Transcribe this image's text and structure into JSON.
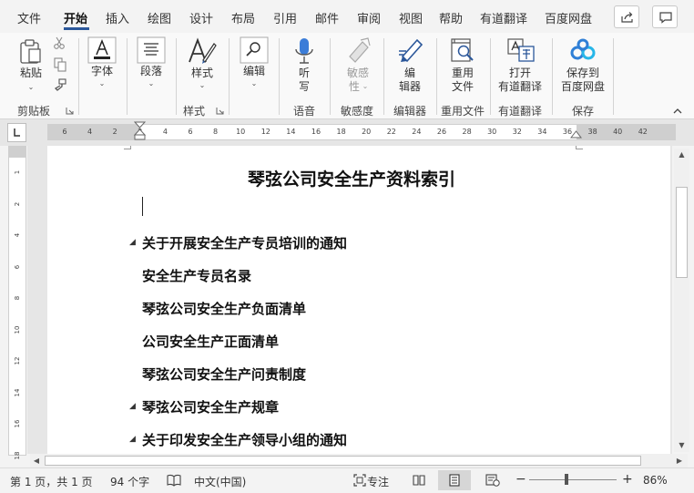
{
  "menu": {
    "items": [
      "文件",
      "开始",
      "插入",
      "绘图",
      "设计",
      "布局",
      "引用",
      "邮件",
      "审阅",
      "视图",
      "帮助",
      "有道翻译",
      "百度网盘"
    ],
    "active_index": 1
  },
  "ribbon": {
    "clipboard": {
      "paste_label": "粘贴",
      "group_label": "剪贴板"
    },
    "font": {
      "label": "字体"
    },
    "paragraph": {
      "label": "段落"
    },
    "styles": {
      "label": "样式",
      "group_label": "样式"
    },
    "editing": {
      "label": "编辑"
    },
    "voice": {
      "label1": "听",
      "label2": "写",
      "group_label": "语音"
    },
    "sensitivity": {
      "label1": "敏感",
      "label2": "性",
      "group_label": "敏感度"
    },
    "editor": {
      "label1": "编",
      "label2": "辑器",
      "group_label": "编辑器"
    },
    "reuse": {
      "label1": "重用",
      "label2": "文件",
      "group_label": "重用文件"
    },
    "youdao": {
      "label1": "打开",
      "label2": "有道翻译",
      "group_label": "有道翻译"
    },
    "baidu": {
      "label1": "保存到",
      "label2": "百度网盘",
      "group_label": "保存"
    }
  },
  "ruler": {
    "h_ticks": [
      "6",
      "4",
      "2",
      "2",
      "4",
      "6",
      "8",
      "10",
      "12",
      "14",
      "16",
      "18",
      "20",
      "22",
      "24",
      "26",
      "28",
      "30",
      "32",
      "34",
      "36",
      "38",
      "40",
      "42"
    ],
    "v_ticks": [
      "1",
      "2",
      "4",
      "6",
      "8",
      "10",
      "12",
      "14",
      "16",
      "18"
    ]
  },
  "document": {
    "title": "琴弦公司安全生产资料索引",
    "headings": [
      {
        "text": "关于开展安全生产专员培训的通知",
        "collapsible": true
      },
      {
        "text": "安全生产专员名录",
        "collapsible": false
      },
      {
        "text": "琴弦公司安全生产负面清单",
        "collapsible": false
      },
      {
        "text": "公司安全生产正面清单",
        "collapsible": false
      },
      {
        "text": "琴弦公司安全生产问责制度",
        "collapsible": false
      },
      {
        "text": "琴弦公司安全生产规章",
        "collapsible": true
      },
      {
        "text": "关于印发安全生产领导小组的通知",
        "collapsible": true
      }
    ]
  },
  "status": {
    "page": "第 1 页，共 1 页",
    "words": "94 个字",
    "language": "中文(中国)",
    "focus": "专注",
    "zoom": "86%",
    "zoom_minus": "−",
    "zoom_plus": "+"
  },
  "colors": {
    "accent": "#2b579a",
    "mic": "#3b7dd8",
    "baidu": "#2f7fd6"
  }
}
